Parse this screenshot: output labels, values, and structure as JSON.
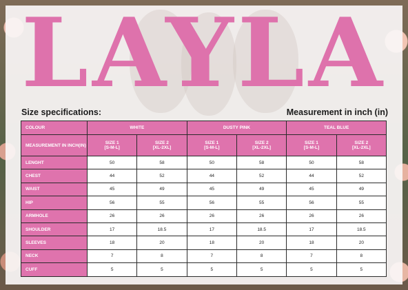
{
  "brand": "LAYLA",
  "header": {
    "left": "Size specifications:",
    "right": "Measurement in inch (in)"
  },
  "table": {
    "colour_label": "COLOUR",
    "measurement_label": "MEASUREMENT IN INCH(IN)",
    "colours": [
      "WHITE",
      "DUSTY PINK",
      "TEAL BLUE"
    ],
    "sizes": [
      {
        "name": "SIZE 1",
        "range": "[S-M-L]"
      },
      {
        "name": "SIZE 2",
        "range": "[XL-2XL]"
      }
    ],
    "rows": [
      {
        "label": "LENGHT",
        "values": [
          "50",
          "58",
          "50",
          "58",
          "50",
          "58"
        ]
      },
      {
        "label": "CHEST",
        "values": [
          "44",
          "52",
          "44",
          "52",
          "44",
          "52"
        ]
      },
      {
        "label": "WAIST",
        "values": [
          "45",
          "49",
          "45",
          "49",
          "45",
          "49"
        ]
      },
      {
        "label": "HIP",
        "values": [
          "56",
          "55",
          "56",
          "55",
          "56",
          "55"
        ]
      },
      {
        "label": "ARMHOLE",
        "values": [
          "26",
          "26",
          "26",
          "26",
          "26",
          "26"
        ]
      },
      {
        "label": "SHOULDER",
        "values": [
          "17",
          "18.5",
          "17",
          "18.5",
          "17",
          "18.5"
        ]
      },
      {
        "label": "SLEEVES",
        "values": [
          "18",
          "20",
          "18",
          "20",
          "18",
          "20"
        ]
      },
      {
        "label": "NECK",
        "values": [
          "7",
          "8",
          "7",
          "8",
          "7",
          "8"
        ]
      },
      {
        "label": "CUFF",
        "values": [
          "5",
          "5",
          "5",
          "5",
          "5",
          "5"
        ]
      }
    ]
  },
  "colors": {
    "accent_pink": "#df73ad",
    "brand_pink": "#de72ac"
  }
}
